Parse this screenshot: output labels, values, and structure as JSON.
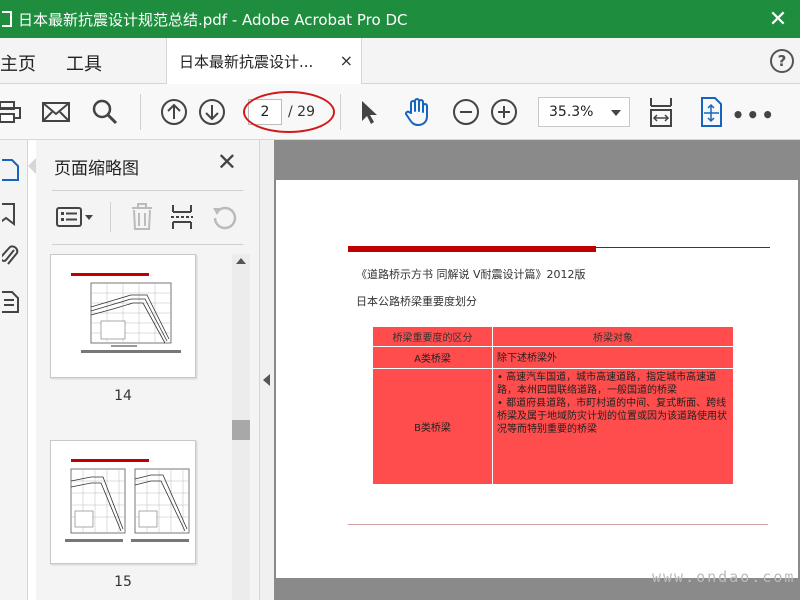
{
  "window": {
    "title": "日本最新抗震设计规范总结.pdf - Adobe Acrobat Pro DC",
    "close_glyph": "✕"
  },
  "menubar": {
    "home_label": "主页",
    "tools_label": "工具",
    "doc_tab_label": "日本最新抗震设计...",
    "doc_tab_close": "×",
    "help_glyph": "?"
  },
  "toolbar": {
    "page_current": "2",
    "page_total": "/ 29",
    "zoom_value": "35.3%",
    "more_glyph": "•••",
    "icons": [
      "print-icon",
      "email-icon",
      "search-icon",
      "page-up-icon",
      "page-down-icon",
      "select-cursor-icon",
      "hand-tool-icon",
      "zoom-out-icon",
      "zoom-in-icon",
      "fit-page-icon",
      "fit-screen-icon"
    ]
  },
  "thumbnail_panel": {
    "title": "页面缩略图",
    "close_glyph": "✕",
    "tools": [
      "thumbnail-options-icon",
      "delete-icon",
      "insert-page-icon",
      "rotate-icon"
    ],
    "thumbnails": [
      {
        "label": "14"
      },
      {
        "label": "15"
      }
    ]
  },
  "document": {
    "header": "《道路桥示方书 同解说 V耐震设计篇》2012版",
    "subtitle": "日本公路桥梁重要度划分",
    "table": {
      "headers": [
        "桥梁重要度的区分",
        "桥梁对象"
      ],
      "rows": [
        {
          "class": "A类桥梁",
          "desc": "除下述桥梁外"
        },
        {
          "class": "B类桥梁",
          "bullets": [
            "• 高速汽车国道，城市高速道路，指定城市高速道路，本州四国联络道路，一般国道的桥梁",
            "• 都道府县道路，市町村道的中间、复式断面、跨线桥梁及属于地域防灾计划的位置或因为该道路使用状况等而特别重要的桥梁"
          ]
        }
      ]
    },
    "colors": {
      "table_fill": "#ff4c4c",
      "rule": "#c00000"
    }
  },
  "watermark": "www.ondao.com",
  "colors": {
    "titlebar": "#1e8e3e",
    "annotation_ellipse": "#d11a1a",
    "hand_tool": "#1565c0"
  }
}
